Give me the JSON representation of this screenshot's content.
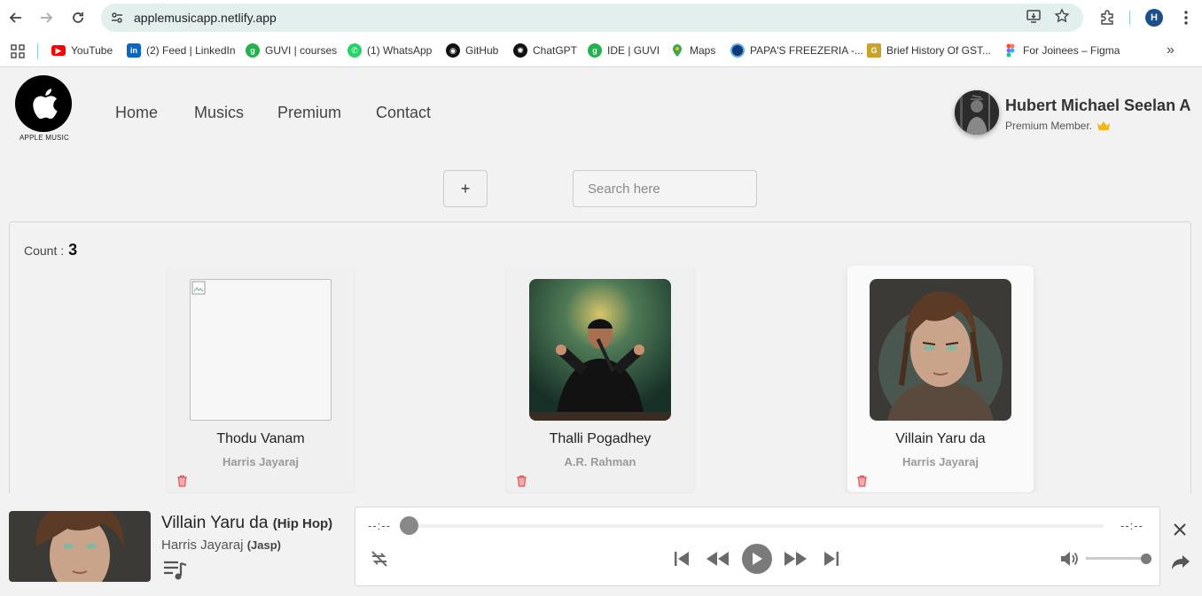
{
  "browser": {
    "url": "applemusicapp.netlify.app",
    "profile_initial": "H",
    "bookmarks": [
      {
        "label": "YouTube",
        "icon": "youtube-icon",
        "color": "#ff0000"
      },
      {
        "label": "(2) Feed | LinkedIn",
        "icon": "linkedin-icon",
        "color": "#0a66c2"
      },
      {
        "label": "GUVI | courses",
        "icon": "guvi-icon",
        "color": "#22b14c"
      },
      {
        "label": "(1) WhatsApp",
        "icon": "whatsapp-icon",
        "color": "#25d366"
      },
      {
        "label": "GitHub",
        "icon": "github-icon",
        "color": "#111111"
      },
      {
        "label": "ChatGPT",
        "icon": "chatgpt-icon",
        "color": "#111111"
      },
      {
        "label": "IDE | GUVI",
        "icon": "guvi-icon",
        "color": "#22b14c"
      },
      {
        "label": "Maps",
        "icon": "maps-icon",
        "color": "#34a853"
      },
      {
        "label": "PAPA'S FREEZERIA -...",
        "icon": "freezeria-icon",
        "color": "#1a73e8"
      },
      {
        "label": "Brief History Of GST...",
        "icon": "gst-icon",
        "color": "#c9a227"
      },
      {
        "label": "For Joinees – Figma",
        "icon": "figma-icon",
        "color": "#f24e1e"
      }
    ]
  },
  "app": {
    "logo_text": "APPLE MUSIC",
    "nav": [
      "Home",
      "Musics",
      "Premium",
      "Contact"
    ],
    "user": {
      "name": "Hubert Michael Seelan A",
      "status": "Premium Member."
    },
    "add_button": "+",
    "search_placeholder": "Search here",
    "count_label": "Count :",
    "count_value": "3",
    "songs": [
      {
        "title": "Thodu Vanam",
        "artist": "Harris Jayaraj",
        "image": "broken"
      },
      {
        "title": "Thalli Pogadhey",
        "artist": "A.R. Rahman",
        "image": "singer"
      },
      {
        "title": "Villain Yaru da",
        "artist": "Harris Jayaraj",
        "image": "portrait"
      }
    ]
  },
  "player": {
    "title": "Villain Yaru da",
    "genre": "(Hip Hop)",
    "artist": "Harris Jayaraj",
    "label": "(Jasp)",
    "time_current": "--:--",
    "time_total": "--:--",
    "progress": 0,
    "volume": 1.0
  },
  "colors": {
    "accent_gray": "#7a7a7a",
    "trash_red": "#e05a5a",
    "crown_gold": "#f2b619"
  }
}
